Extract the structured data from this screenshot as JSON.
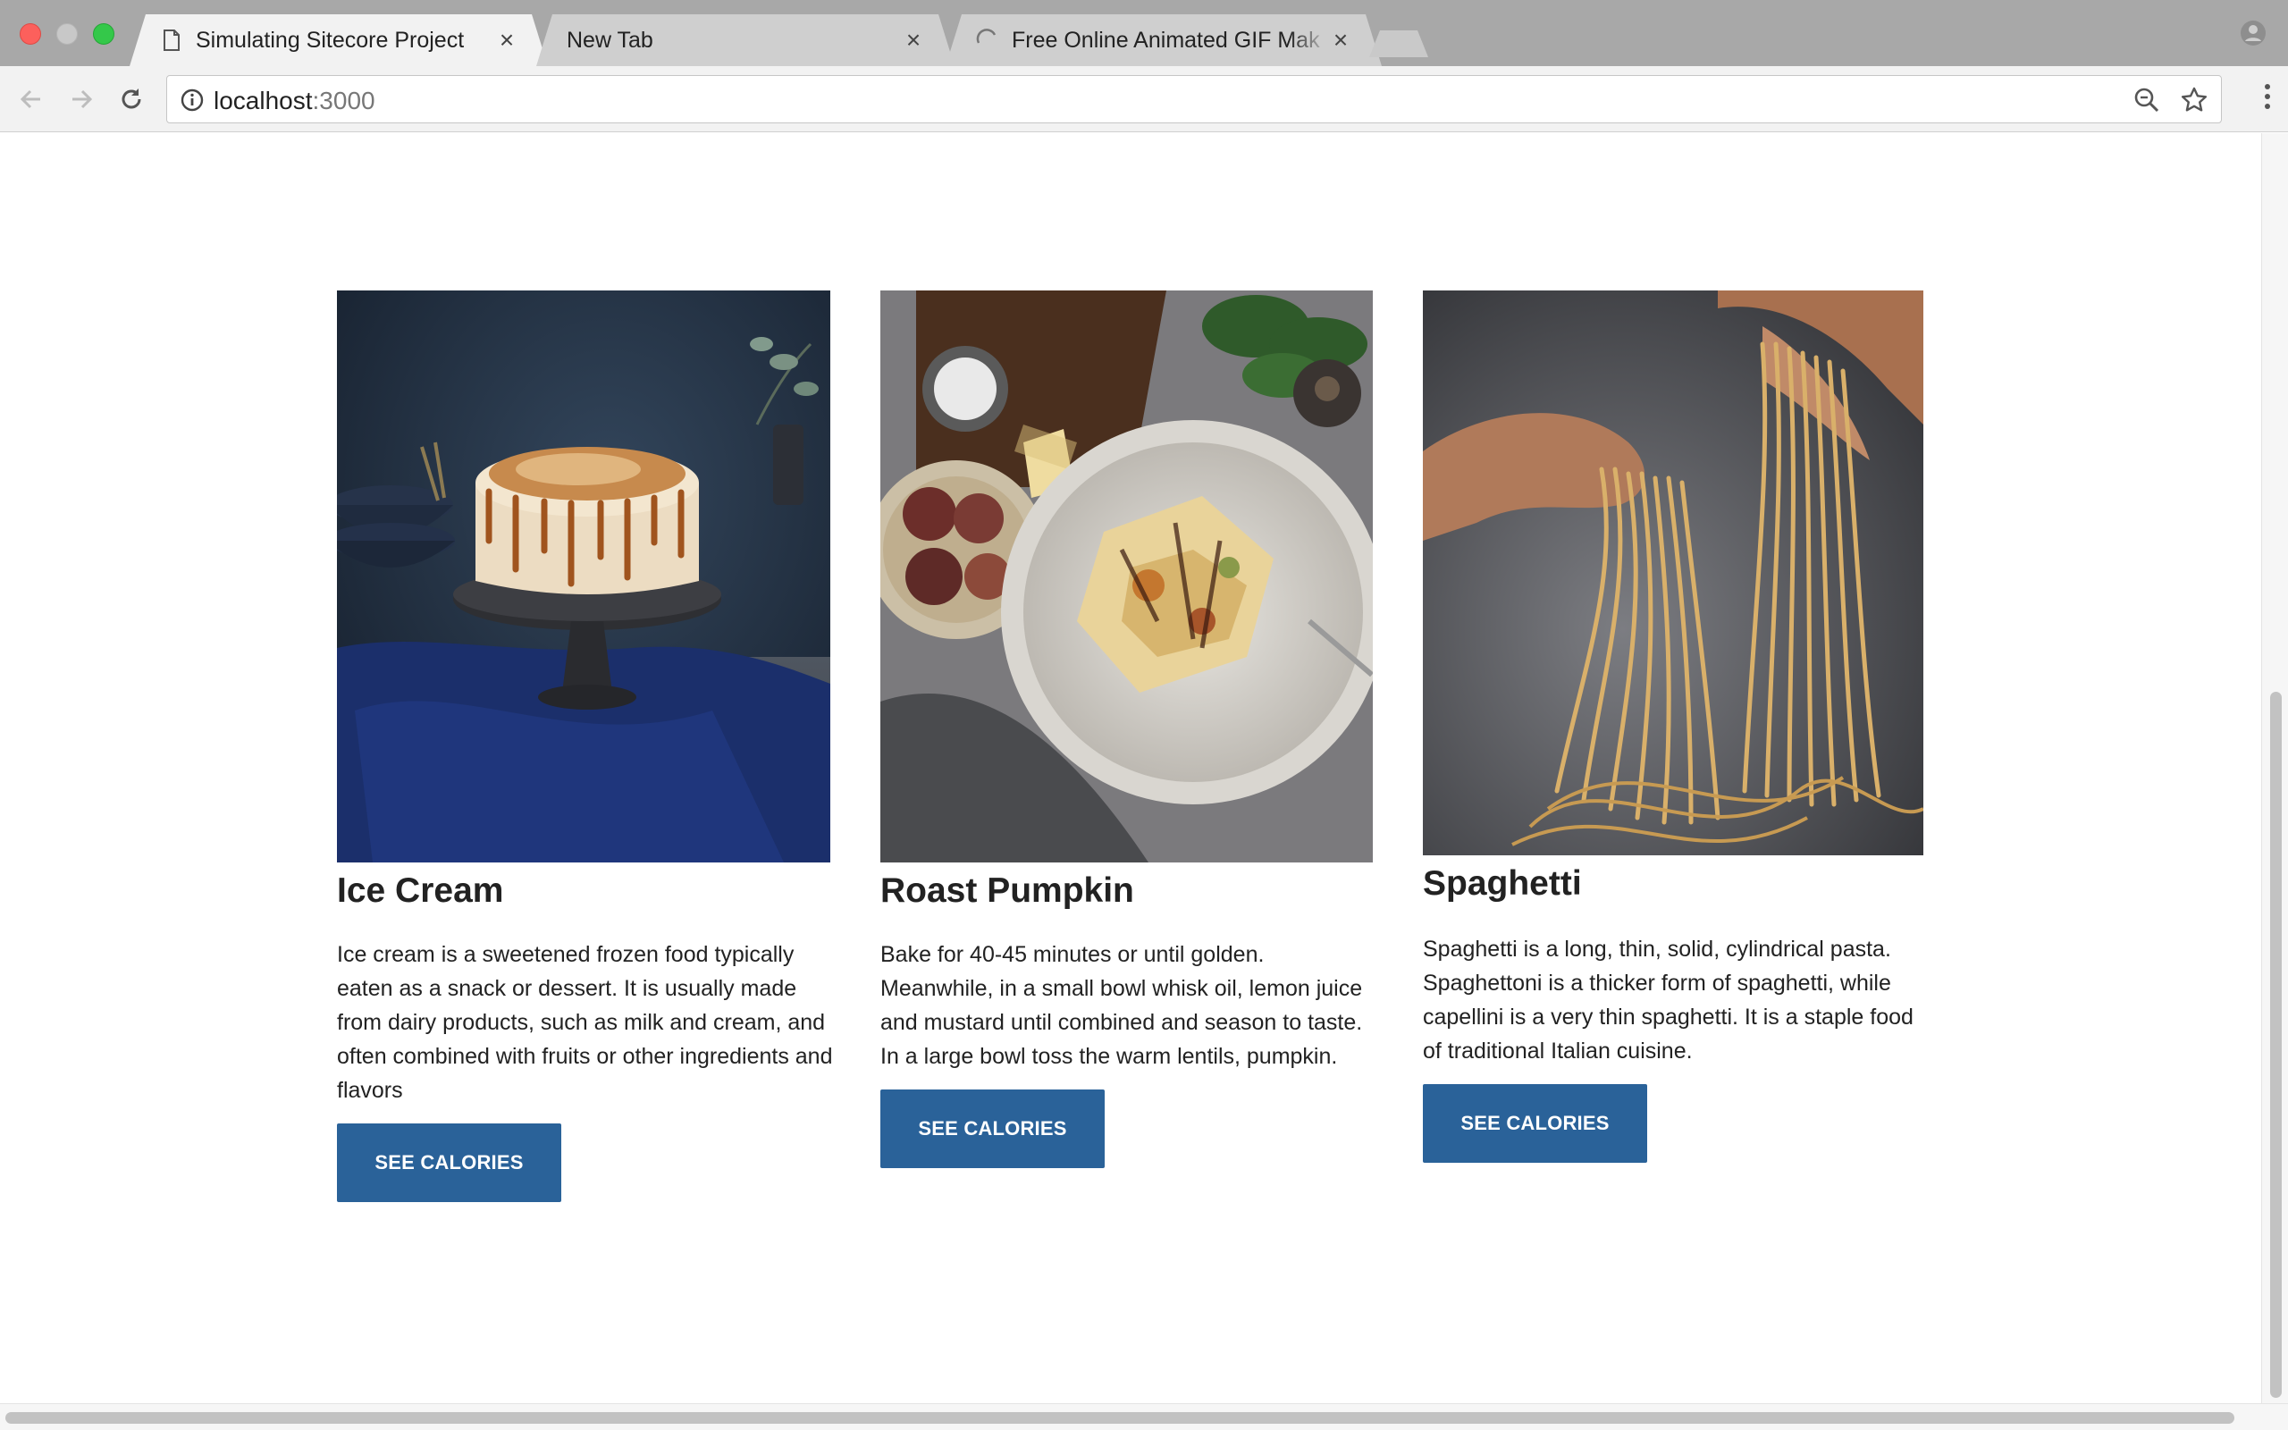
{
  "browser": {
    "tabs": [
      {
        "title": "Simulating Sitecore Project",
        "icon": "document-icon",
        "active": true
      },
      {
        "title": "New Tab",
        "icon": "",
        "active": false
      },
      {
        "title": "Free Online Animated GIF Mak",
        "icon": "loading-spinner-icon",
        "active": false
      }
    ],
    "address": {
      "host": "localhost",
      "port": ":3000"
    },
    "colors": {
      "tabbar": "#a8a8a8",
      "toolbar": "#f2f2f2"
    }
  },
  "cards": [
    {
      "title": "Ice Cream",
      "description": "Ice cream is a sweetened frozen food typically eaten as a snack or dessert. It is usually made from dairy products, such as milk and cream, and often combined with fruits or other ingredients and flavors",
      "button": "SEE CALORIES",
      "image": "cake-photo"
    },
    {
      "title": "Roast Pumpkin",
      "description": "Bake for 40-45 minutes or until golden. Meanwhile, in a small bowl whisk oil, lemon juice and mustard until combined and season to taste. In a large bowl toss the warm lentils, pumpkin.",
      "button": "SEE CALORIES",
      "image": "pasta-plate-photo"
    },
    {
      "title": "Spaghetti",
      "description": "Spaghetti is a long, thin, solid, cylindrical pasta. Spaghettoni is a thicker form of spaghetti, while capellini is a very thin spaghetti. It is a staple food of traditional Italian cuisine.",
      "button": "SEE CALORIES",
      "image": "fresh-pasta-photo"
    }
  ],
  "theme": {
    "button": "#2a6299",
    "text": "#222222"
  }
}
